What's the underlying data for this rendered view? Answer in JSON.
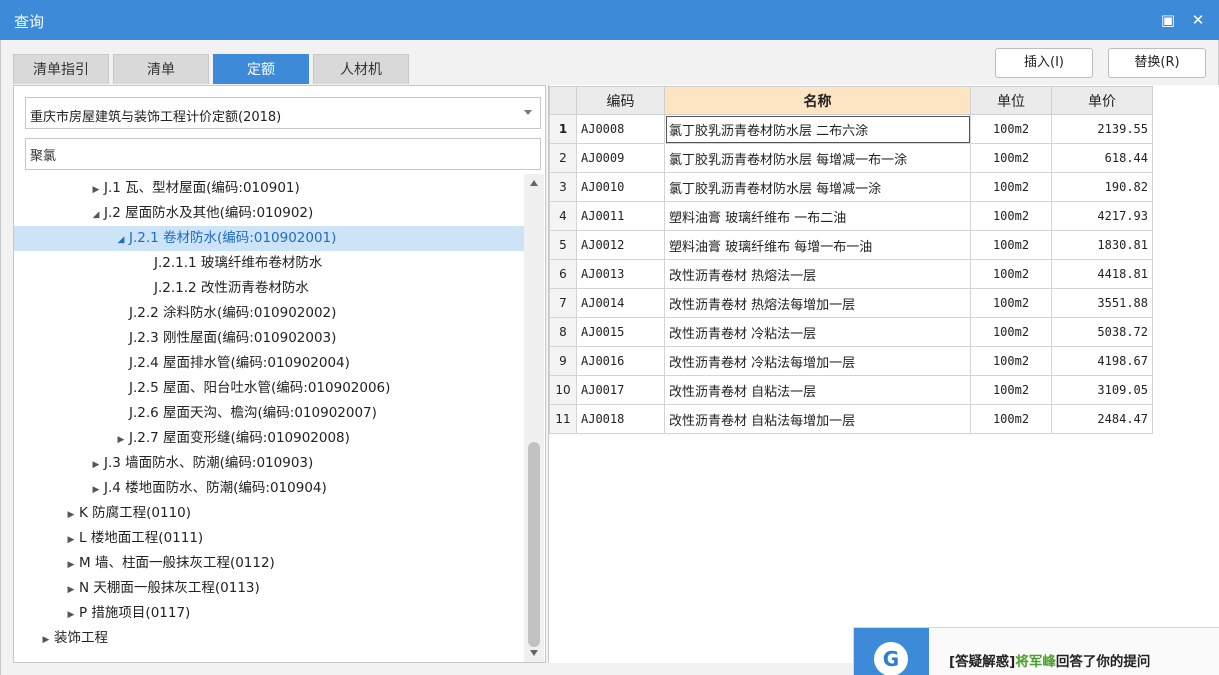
{
  "window": {
    "title": "查询",
    "maximize_icon": "maximize-icon",
    "close_icon": "close-icon"
  },
  "tabs": [
    {
      "label": "清单指引",
      "active": false
    },
    {
      "label": "清单",
      "active": false
    },
    {
      "label": "定额",
      "active": true
    },
    {
      "label": "人材机",
      "active": false
    }
  ],
  "actions": {
    "insert": "插入(I)",
    "replace": "替换(R)"
  },
  "left": {
    "dropdown_value": "重庆市房屋建筑与装饰工程计价定额(2018)",
    "search_value": "聚氯",
    "tree": [
      {
        "label": "J.1 瓦、型材屋面(编码:010901)",
        "level": 2,
        "arrow": "▶",
        "selected": false
      },
      {
        "label": "J.2 屋面防水及其他(编码:010902)",
        "level": 2,
        "arrow": "◢",
        "selected": false
      },
      {
        "label": "J.2.1 卷材防水(编码:010902001)",
        "level": 3,
        "arrow": "◢",
        "selected": true
      },
      {
        "label": "J.2.1.1 玻璃纤维布卷材防水",
        "level": 4,
        "arrow": "",
        "selected": false
      },
      {
        "label": "J.2.1.2 改性沥青卷材防水",
        "level": 4,
        "arrow": "",
        "selected": false
      },
      {
        "label": "J.2.2 涂料防水(编码:010902002)",
        "level": 3,
        "arrow": "",
        "selected": false
      },
      {
        "label": "J.2.3 刚性屋面(编码:010902003)",
        "level": 3,
        "arrow": "",
        "selected": false
      },
      {
        "label": "J.2.4 屋面排水管(编码:010902004)",
        "level": 3,
        "arrow": "",
        "selected": false
      },
      {
        "label": "J.2.5 屋面、阳台吐水管(编码:010902006)",
        "level": 3,
        "arrow": "",
        "selected": false
      },
      {
        "label": "J.2.6 屋面天沟、檐沟(编码:010902007)",
        "level": 3,
        "arrow": "",
        "selected": false
      },
      {
        "label": "J.2.7 屋面变形缝(编码:010902008)",
        "level": 3,
        "arrow": "▶",
        "selected": false
      },
      {
        "label": "J.3 墙面防水、防潮(编码:010903)",
        "level": 2,
        "arrow": "▶",
        "selected": false
      },
      {
        "label": "J.4 楼地面防水、防潮(编码:010904)",
        "level": 2,
        "arrow": "▶",
        "selected": false
      },
      {
        "label": "K 防腐工程(0110)",
        "level": 1,
        "arrow": "▶",
        "selected": false
      },
      {
        "label": "L 楼地面工程(0111)",
        "level": 1,
        "arrow": "▶",
        "selected": false
      },
      {
        "label": "M 墙、柱面一般抹灰工程(0112)",
        "level": 1,
        "arrow": "▶",
        "selected": false
      },
      {
        "label": "N 天棚面一般抹灰工程(0113)",
        "level": 1,
        "arrow": "▶",
        "selected": false
      },
      {
        "label": "P 措施项目(0117)",
        "level": 1,
        "arrow": "▶",
        "selected": false
      },
      {
        "label": "装饰工程",
        "level": 0,
        "arrow": "▶",
        "selected": false
      }
    ]
  },
  "grid": {
    "columns": {
      "code": "编码",
      "name": "名称",
      "unit": "单位",
      "price": "单价"
    },
    "rows": [
      {
        "n": "1",
        "code": "AJ0008",
        "name": "氯丁胶乳沥青卷材防水层 二布六涂",
        "unit": "100m2",
        "price": "2139.55"
      },
      {
        "n": "2",
        "code": "AJ0009",
        "name": "氯丁胶乳沥青卷材防水层 每增减一布一涂",
        "unit": "100m2",
        "price": "618.44"
      },
      {
        "n": "3",
        "code": "AJ0010",
        "name": "氯丁胶乳沥青卷材防水层 每增减一涂",
        "unit": "100m2",
        "price": "190.82"
      },
      {
        "n": "4",
        "code": "AJ0011",
        "name": "塑料油膏 玻璃纤维布 一布二油",
        "unit": "100m2",
        "price": "4217.93"
      },
      {
        "n": "5",
        "code": "AJ0012",
        "name": "塑料油膏 玻璃纤维布 每增一布一油",
        "unit": "100m2",
        "price": "1830.81"
      },
      {
        "n": "6",
        "code": "AJ0013",
        "name": "改性沥青卷材 热熔法一层",
        "unit": "100m2",
        "price": "4418.81"
      },
      {
        "n": "7",
        "code": "AJ0014",
        "name": "改性沥青卷材 热熔法每增加一层",
        "unit": "100m2",
        "price": "3551.88"
      },
      {
        "n": "8",
        "code": "AJ0015",
        "name": "改性沥青卷材 冷粘法一层",
        "unit": "100m2",
        "price": "5038.72"
      },
      {
        "n": "9",
        "code": "AJ0016",
        "name": "改性沥青卷材 冷粘法每增加一层",
        "unit": "100m2",
        "price": "4198.67"
      },
      {
        "n": "10",
        "code": "AJ0017",
        "name": "改性沥青卷材 自粘法一层",
        "unit": "100m2",
        "price": "3109.05"
      },
      {
        "n": "11",
        "code": "AJ0018",
        "name": "改性沥青卷材 自粘法每增加一层",
        "unit": "100m2",
        "price": "2484.47"
      }
    ]
  },
  "notification": {
    "icon_letter": "G",
    "prefix": "[答疑解惑]",
    "user": "将军峰",
    "suffix": "回答了你的提问"
  },
  "colors": {
    "accent": "#3c8ad8",
    "selected_bg": "#cde3f7",
    "sorted_header": "#fde5c4",
    "highlight_user": "#4aa02c"
  }
}
